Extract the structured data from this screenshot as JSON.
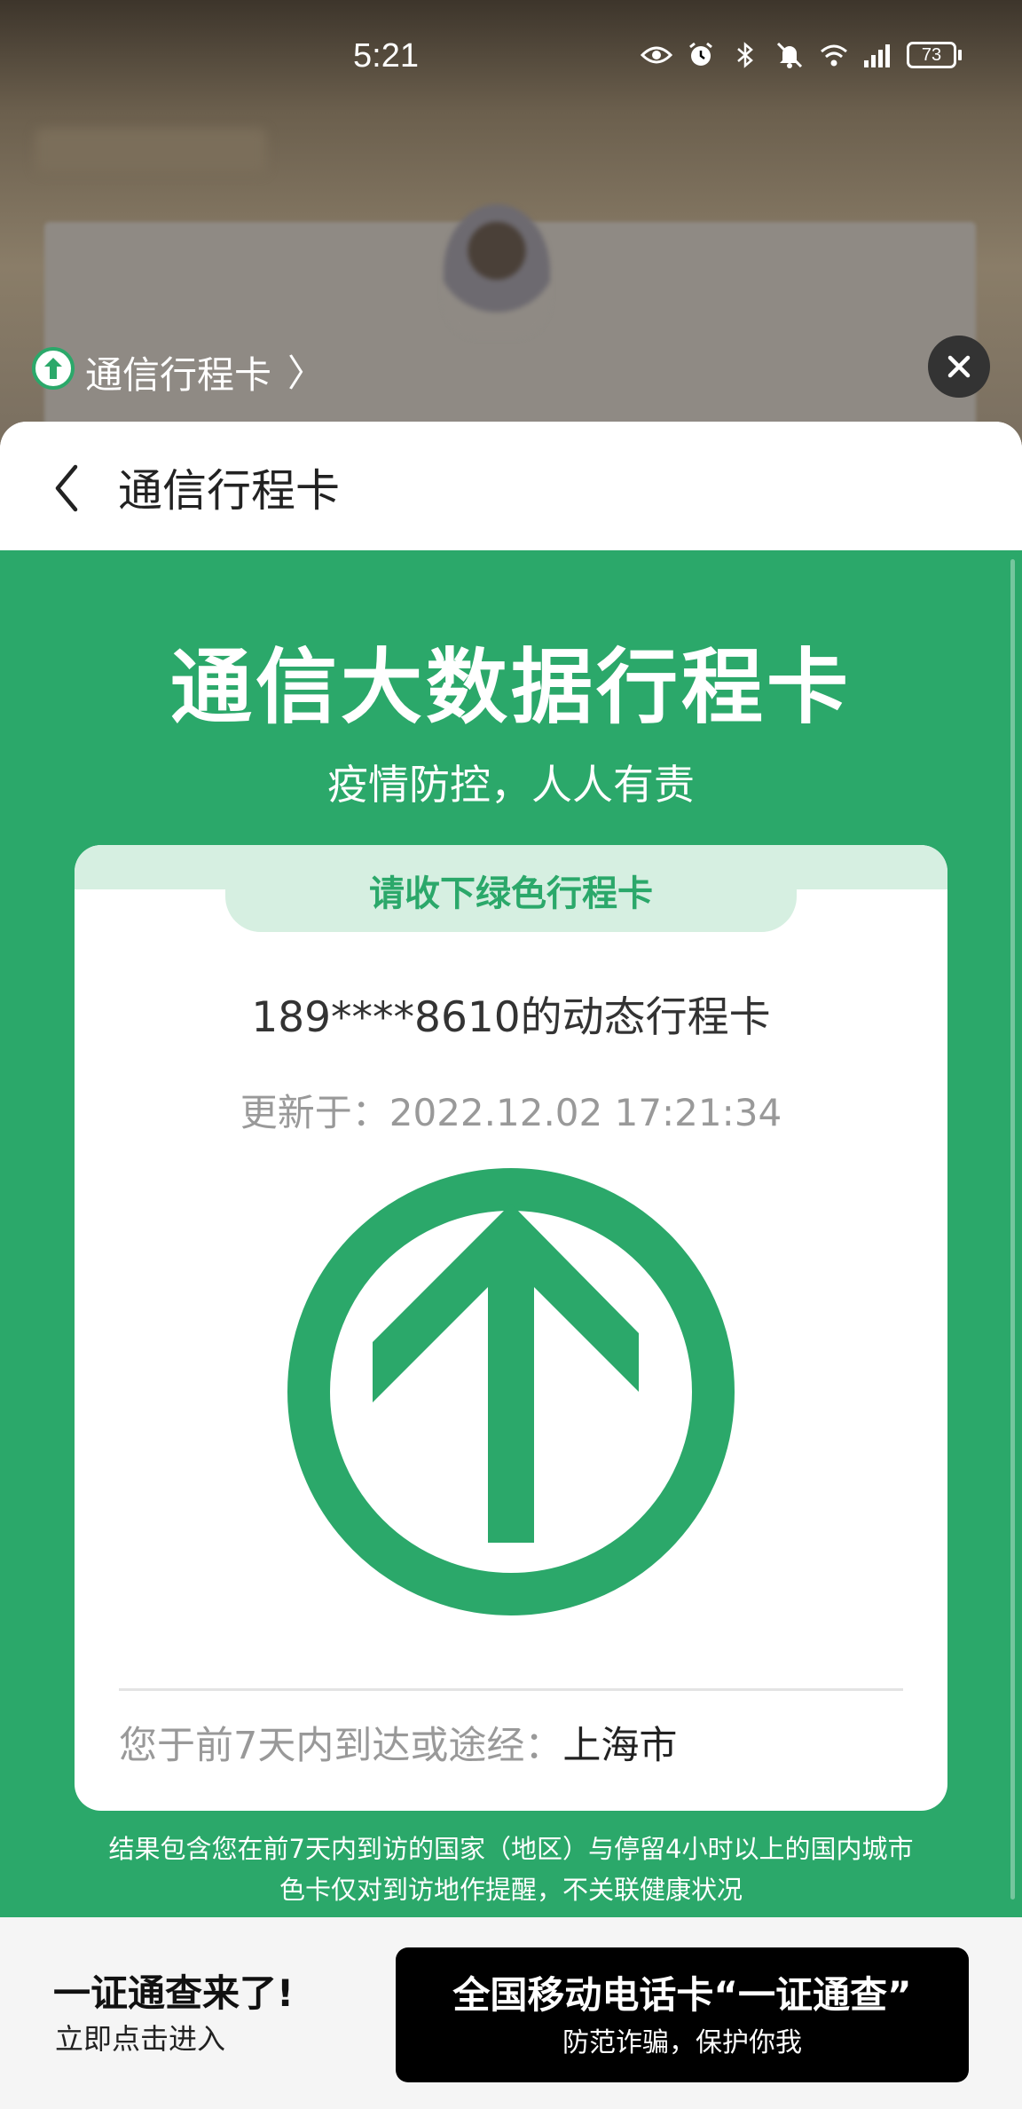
{
  "status_bar": {
    "time": "5:21",
    "battery": "73",
    "icons": [
      "eye-icon",
      "alarm-icon",
      "bluetooth-icon",
      "mute-icon",
      "wifi-icon",
      "signal-icon"
    ]
  },
  "miniapp": {
    "title": "通信行程卡",
    "chevron": "〉"
  },
  "nav": {
    "title": "通信行程卡"
  },
  "header": {
    "title": "通信大数据行程卡",
    "subtitle": "疫情防控，人人有责"
  },
  "card": {
    "tab_label": "请收下绿色行程卡",
    "phone_line": "189****8610的动态行程卡",
    "updated": "更新于：2022.12.02 17:21:34",
    "status_color": "#2ba86a",
    "visited_label": "您于前7天内到达或途经：",
    "visited_city": "上海市"
  },
  "footnote": {
    "line1": "结果包含您在前7天内到访的国家（地区）与停留4小时以上的国内城市",
    "line2": "色卡仅对到访地作提醒，不关联健康状况"
  },
  "promo": {
    "title": "一证通查来了!",
    "subtitle": "立即点击进入",
    "button_title": "全国移动电话卡“一证通查”",
    "button_subtitle": "防范诈骗，保护你我"
  },
  "colors": {
    "accent": "#2ba86a",
    "tab_bg": "#d6efe1"
  }
}
